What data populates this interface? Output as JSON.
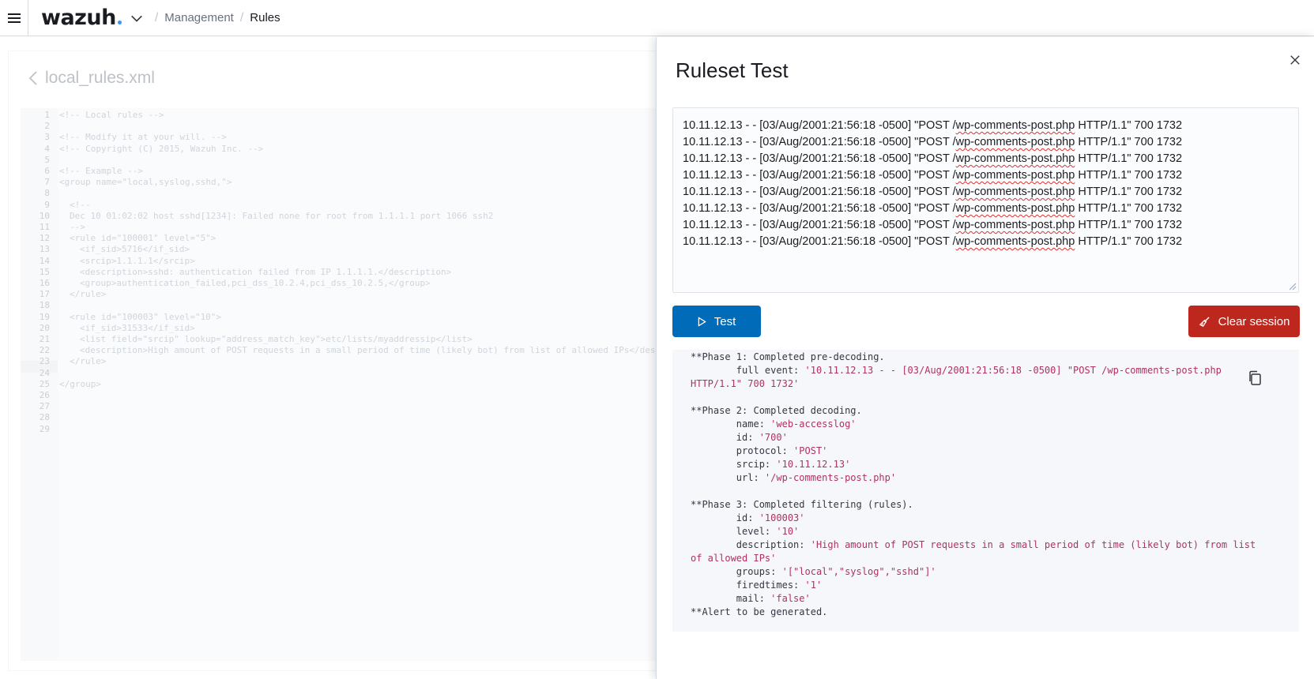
{
  "header": {
    "logo_text": "wazuh",
    "breadcrumb": [
      "Management",
      "Rules"
    ]
  },
  "editor": {
    "file_name": "local_rules.xml",
    "lines": [
      {
        "n": "1",
        "text": "<!-- Local rules -->",
        "indent": 0
      },
      {
        "n": "2",
        "text": "",
        "indent": 0
      },
      {
        "n": "3",
        "text": "<!-- Modify it at your will. -->",
        "indent": 0
      },
      {
        "n": "4",
        "text": "<!-- Copyright (C) 2015, Wazuh Inc. -->",
        "indent": 0
      },
      {
        "n": "5",
        "text": "",
        "indent": 0
      },
      {
        "n": "6",
        "text": "<!-- Example -->",
        "indent": 0
      },
      {
        "n": "7",
        "text": "<group name=\"local,syslog,sshd,\">",
        "indent": 0
      },
      {
        "n": "8",
        "text": "",
        "indent": 0
      },
      {
        "n": "9",
        "text": "<!--",
        "indent": 1
      },
      {
        "n": "10",
        "text": "Dec 10 01:02:02 host sshd[1234]: Failed none for root from 1.1.1.1 port 1066 ssh2",
        "indent": 1
      },
      {
        "n": "11",
        "text": "-->",
        "indent": 1
      },
      {
        "n": "12",
        "text": "<rule id=\"100001\" level=\"5\">",
        "indent": 1
      },
      {
        "n": "13",
        "text": "<if_sid>5716</if_sid>",
        "indent": 2
      },
      {
        "n": "14",
        "text": "<srcip>1.1.1.1</srcip>",
        "indent": 2
      },
      {
        "n": "15",
        "text": "<description>sshd: authentication failed from IP 1.1.1.1.</description>",
        "indent": 2
      },
      {
        "n": "16",
        "text": "<group>authentication_failed,pci_dss_10.2.4,pci_dss_10.2.5,</group>",
        "indent": 2
      },
      {
        "n": "17",
        "text": "</rule>",
        "indent": 1
      },
      {
        "n": "18",
        "text": "",
        "indent": 0
      },
      {
        "n": "19",
        "text": "<rule id=\"100003\" level=\"10\">",
        "indent": 1
      },
      {
        "n": "20",
        "text": "<if_sid>31533</if_sid>",
        "indent": 2
      },
      {
        "n": "21",
        "text": "<list field=\"srcip\" lookup=\"address_match_key\">etc/lists/myaddressip</list>",
        "indent": 2
      },
      {
        "n": "22",
        "text": "<description>High amount of POST requests in a small period of time (likely bot) from list of allowed IPs</description>",
        "indent": 2
      },
      {
        "n": "23",
        "text": "</rule>",
        "indent": 1
      },
      {
        "n": "24",
        "text": "",
        "indent": 0
      },
      {
        "n": "25",
        "text": "</group>",
        "indent": 0
      },
      {
        "n": "26",
        "text": "",
        "indent": 0
      },
      {
        "n": "27",
        "text": "",
        "indent": 0
      },
      {
        "n": "28",
        "text": "",
        "indent": 0
      },
      {
        "n": "29",
        "text": "",
        "indent": 0
      }
    ]
  },
  "flyout": {
    "title": "Ruleset Test",
    "log_prefix": "10.11.12.13 - - [03/Aug/2001:21:56:18 -0500] \"POST /",
    "log_path": "wp-comments-post.php",
    "log_suffix": " HTTP/1.1\" 700 1732",
    "log_line_count": 8,
    "test_button": "Test",
    "clear_button": "Clear session",
    "output": {
      "phase1_header": "**Phase 1: Completed pre-decoding.",
      "full_event_label": "        full event: ",
      "full_event_line1": "'10.11.12.13 - - [03/Aug/2001:21:56:18 -0500] \"POST /wp-comments-post.php",
      "full_event_line2": "HTTP/1.1\" 700 1732'",
      "phase2_header": "**Phase 2: Completed decoding.",
      "decoding": [
        {
          "key": "name",
          "value": "'web-accesslog'"
        },
        {
          "key": "id",
          "value": "'700'"
        },
        {
          "key": "protocol",
          "value": "'POST'"
        },
        {
          "key": "srcip",
          "value": "'10.11.12.13'"
        },
        {
          "key": "url",
          "value": "'/wp-comments-post.php'"
        }
      ],
      "phase3_header": "**Phase 3: Completed filtering (rules).",
      "filtering": [
        {
          "key": "id",
          "value": "'100003'"
        },
        {
          "key": "level",
          "value": "'10'"
        },
        {
          "key": "description",
          "value": "'High amount of POST requests in a small period of time (likely bot) from list"
        }
      ],
      "description_cont": "of allowed IPs'",
      "filtering2": [
        {
          "key": "groups",
          "value": "'[\"local\",\"syslog\",\"sshd\"]'"
        },
        {
          "key": "firedtimes",
          "value": "'1'"
        },
        {
          "key": "mail",
          "value": "'false'"
        }
      ],
      "alert": "**Alert to be generated."
    }
  }
}
